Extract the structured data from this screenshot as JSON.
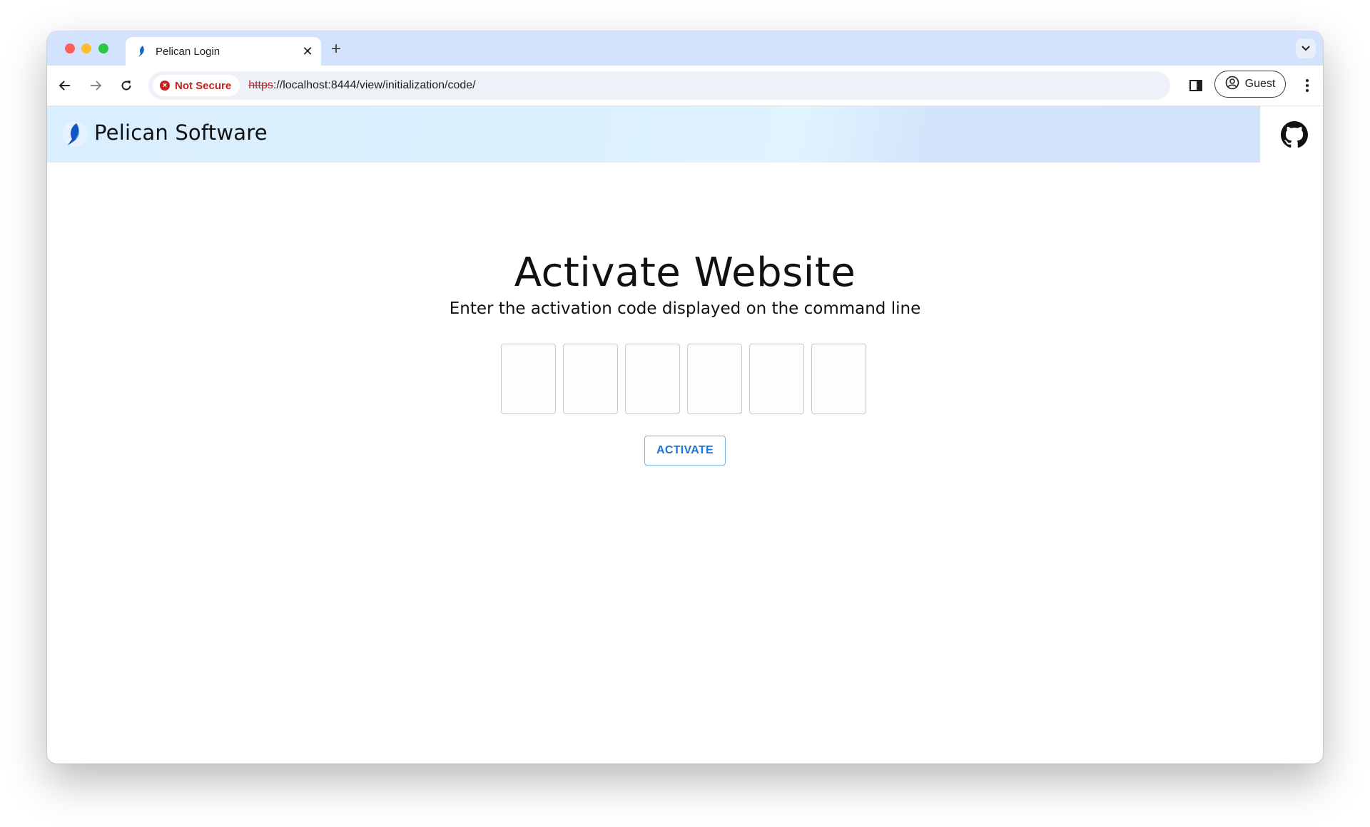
{
  "browser": {
    "tab": {
      "title": "Pelican Login"
    },
    "new_tab_symbol": "+",
    "close_symbol": "✕",
    "security_chip": {
      "label": "Not Secure",
      "icon": "error-icon"
    },
    "url": {
      "scheme": "https",
      "rest": "://localhost:8444/view/initialization/code/"
    },
    "profile": {
      "label": "Guest"
    }
  },
  "site": {
    "brand": "Pelican Software"
  },
  "main": {
    "title": "Activate Website",
    "subtitle": "Enter the activation code displayed on the command line",
    "code_values": [
      "",
      "",
      "",
      "",
      "",
      ""
    ],
    "activate_label": "ACTIVATE"
  },
  "colors": {
    "accent": "#1976d2",
    "not_secure": "#c5221f",
    "tabstrip": "#d3e3fd",
    "header_gradient_start": "#d9eefe"
  }
}
